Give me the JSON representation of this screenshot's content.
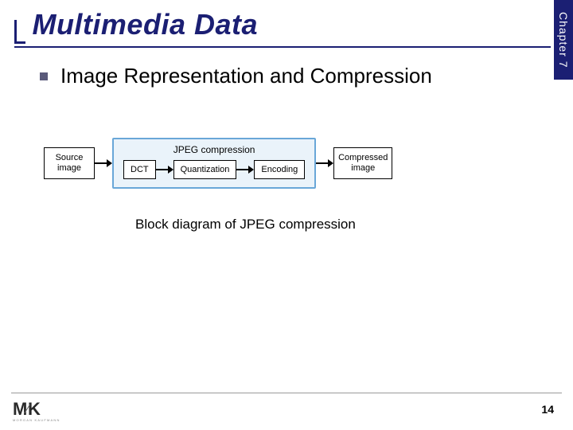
{
  "chapter_tab": "Chapter 7",
  "title": "Multimedia Data",
  "bullet": "Image Representation and Compression",
  "diagram": {
    "source": "Source\nimage",
    "group_label": "JPEG compression",
    "step1": "DCT",
    "step2": "Quantization",
    "step3": "Encoding",
    "output": "Compressed\nimage"
  },
  "caption": "Block diagram of JPEG compression",
  "logo_main": "M",
  "logo_k": "K",
  "logo_slash": "⁄",
  "logo_sub": "MORGAN KAUFMANN",
  "page_number": "14"
}
